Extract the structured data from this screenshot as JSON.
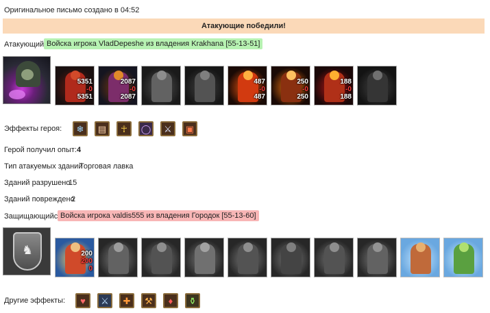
{
  "header": {
    "created": "Оригинальное письмо создано в 04:52",
    "result": "Атакующие победили!"
  },
  "attacker": {
    "label": "Атакующий",
    "name": "Войска игрока VladDepeshe из владения Krakhana [55-13-51]",
    "units": [
      {
        "name": "red-dragon-unit",
        "top": "5351",
        "mid": "-0",
        "bottom": "5351"
      },
      {
        "name": "lich-unit",
        "top": "2087",
        "mid": "-0",
        "bottom": "2087"
      },
      {
        "name": "gargoyle-unit"
      },
      {
        "name": "bone-dragon-unit"
      },
      {
        "name": "fire-elemental-unit",
        "top": "487",
        "mid": "-0",
        "bottom": "487"
      },
      {
        "name": "efreet-unit",
        "top": "250",
        "mid": "-0",
        "bottom": "250"
      },
      {
        "name": "devil-unit",
        "top": "188",
        "mid": "-0",
        "bottom": "188"
      },
      {
        "name": "wraith-unit"
      }
    ]
  },
  "hero_effects": {
    "label": "Эффекты героя:",
    "icons": [
      "frost-icon",
      "scroll-icon",
      "ankh-icon",
      "ring-icon",
      "sword-icon",
      "chest-icon"
    ]
  },
  "stats": {
    "exp_label": "Герой получил опыт:",
    "exp_value": "4",
    "buildings_type_label": "Тип атакуемых зданий",
    "buildings_type_value": "Торговая лавка",
    "destroyed_label": "Зданий разрушено",
    "destroyed_value": "15",
    "damaged_label": "Зданий повреждено",
    "damaged_value": "2"
  },
  "defender": {
    "label": "Защищающийся",
    "name": "Войска игрока valdis555 из владения Городок [55-13-60]",
    "units": [
      {
        "name": "king-unit",
        "top": "200",
        "mid": "200",
        "bottom": "0"
      },
      {
        "name": "swordsman-unit"
      },
      {
        "name": "cavalry-unit"
      },
      {
        "name": "griffin-unit"
      },
      {
        "name": "archer-unit"
      },
      {
        "name": "monk-unit"
      },
      {
        "name": "paladin-unit"
      },
      {
        "name": "angel-unit"
      },
      {
        "name": "tower-unit"
      },
      {
        "name": "mage-tower-unit"
      }
    ]
  },
  "other_effects": {
    "label": "Другие эффекты:",
    "icons": [
      "armor-icon",
      "blade-icon",
      "axe-icon",
      "hammer-icon",
      "shield-buff-icon",
      "potion-icon"
    ]
  }
}
